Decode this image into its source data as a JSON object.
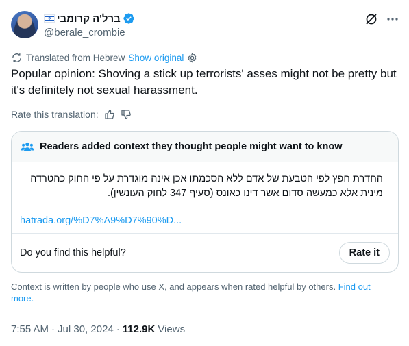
{
  "author": {
    "display_name": "ברל'ה קרומבי",
    "handle": "@berale_crombie",
    "flag": "flag-icon",
    "verified": "verified-badge-icon"
  },
  "header_icons": [
    "grok-icon",
    "more-icon"
  ],
  "translation": {
    "label": "Translated from Hebrew",
    "show_original": "Show original"
  },
  "tweet": {
    "text": "Popular opinion: Shoving a stick up terrorists' asses might not be pretty but it's definitely not sexual harassment."
  },
  "rate_translation": {
    "label": "Rate this translation:"
  },
  "community_note": {
    "title": "Readers added context they thought people might want to know",
    "text": "החדרת חפץ לפי הטבעת של אדם ללא הסכמתו אכן אינה מוגדרת על פי החוק כהטרדה מינית אלא כמעשה סדום אשר דינו כאונס (סעיף 347 לחוק העונשין).",
    "link": "hatrada.org/%D7%A9%D7%90%D...",
    "question": "Do you find this helpful?",
    "rate_button": "Rate it"
  },
  "context_footer": {
    "text": "Context is written by people who use X, and appears when rated helpful by others.",
    "link": "Find out more."
  },
  "meta": {
    "time": "7:55 AM",
    "sep1": "·",
    "date": "Jul 30, 2024",
    "sep2": "·",
    "views_count": "112.9K",
    "views_label": "Views"
  },
  "colors": {
    "accent": "#1d9bf0",
    "text": "#0f1419",
    "muted": "#536471",
    "border": "#cfd9de"
  }
}
